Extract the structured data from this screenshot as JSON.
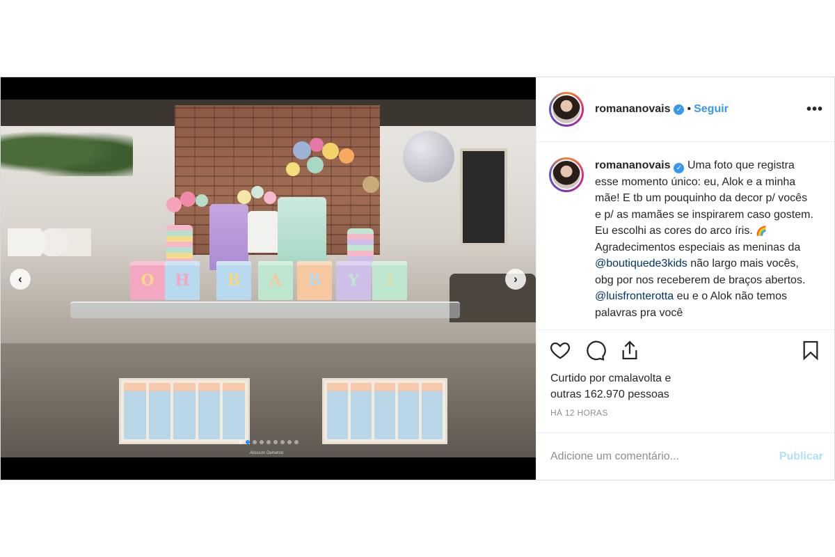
{
  "post": {
    "photo_watermark": "Alissson Demetrio",
    "letters": [
      "O",
      "H",
      "B",
      "A",
      "B",
      "Y",
      "!"
    ],
    "letter_colors": [
      "#f4a7c0",
      "#b9d9ef",
      "#f6d88a",
      "#bfe6cf",
      "#f7c7a0",
      "#cdbfe8",
      "#bfe6cf"
    ],
    "carousel": {
      "slide_count": 9,
      "active_index": 1
    }
  },
  "header": {
    "username": "romananovais",
    "separator": "•",
    "follow_label": "Seguir",
    "more_label": "•••"
  },
  "caption": {
    "username": "romananovais",
    "text_1": "Uma foto que registra esse momento único: eu, Alok e a minha mãe! E tb um pouquinho da decor p/ vocês e p/ as mamães se inspirarem caso gostem. Eu escolhi as cores do arco íris.",
    "emoji": "🌈",
    "text_2": "Agradecimentos especiais as meninas da",
    "mention_1": "@boutiquede3kids",
    "text_3": "não largo mais vocês, obg por nos receberem de braços abertos.",
    "mention_2": "@luisfronterotta",
    "text_4": "eu e o Alok não temos palavras pra você"
  },
  "likes": {
    "line_1": "Curtido por cmalavolta e",
    "line_2": "outras 162.970 pessoas"
  },
  "timestamp": "HÁ 12 HORAS",
  "comment": {
    "placeholder": "Adicione um comentário...",
    "publish_label": "Publicar"
  },
  "icons": {
    "like": "heart-icon",
    "comment": "comment-icon",
    "share": "share-icon",
    "save": "bookmark-icon",
    "verified": "verified-badge-icon",
    "prev": "chevron-left-icon",
    "next": "chevron-right-icon"
  },
  "colors": {
    "link_blue": "#3897f0",
    "mention": "#003569",
    "publish_disabled": "#b2dffc",
    "muted": "#8e8e8e",
    "active_dot": "#1e90ff"
  }
}
